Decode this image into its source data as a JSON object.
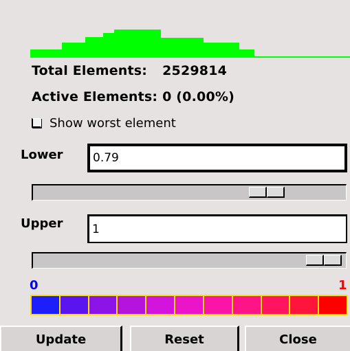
{
  "stats": {
    "total_label": "Total Elements:",
    "total_value": "2529814",
    "active_label": "Active Elements:",
    "active_value": "0 (0.00%)"
  },
  "show_worst": {
    "label": "Show worst element",
    "checked": false
  },
  "lower": {
    "label": "Lower",
    "value": "0.79",
    "slider_position": 0.79
  },
  "upper": {
    "label": "Upper",
    "value": "1",
    "slider_position": 1.0
  },
  "color_scale": {
    "min_label": "0",
    "max_label": "1",
    "colors": [
      "#1e1efa",
      "#5a14f0",
      "#8c14e6",
      "#b414dc",
      "#d214dc",
      "#ec14c8",
      "#fa14a8",
      "#ff1488",
      "#ff1462",
      "#ff143c",
      "#ff0000"
    ]
  },
  "buttons": {
    "update": "Update",
    "reset": "Reset",
    "close": "Close"
  },
  "colors": {
    "histogram": "#00ff00",
    "background": "#e6e2e2"
  }
}
